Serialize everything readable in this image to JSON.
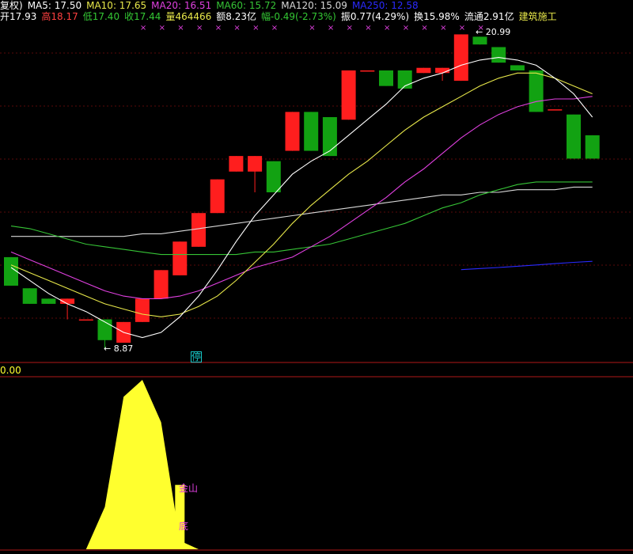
{
  "header": {
    "row1": [
      {
        "text": "复权)",
        "color": "#ffffff"
      },
      {
        "text": "MA5: 17.50",
        "color": "#ffffff"
      },
      {
        "text": "MA10: 17.65",
        "color": "#e8e84a"
      },
      {
        "text": "MA20: 16.51",
        "color": "#e040e0"
      },
      {
        "text": "MA60: 15.72",
        "color": "#36c436"
      },
      {
        "text": "MA120: 15.09",
        "color": "#d8d8d8"
      },
      {
        "text": "MA250: 12.58",
        "color": "#2a2aff"
      }
    ],
    "row2": [
      {
        "text": "开17.93",
        "color": "#ffffff"
      },
      {
        "text": "高18.17",
        "color": "#ff4040"
      },
      {
        "text": "低17.40",
        "color": "#34c834"
      },
      {
        "text": "收17.44",
        "color": "#34c834"
      },
      {
        "text": "量464466",
        "color": "#e8e84a"
      },
      {
        "text": "额8.23亿",
        "color": "#ffffff"
      },
      {
        "text": "幅-0.49(-2.73%)",
        "color": "#34c834"
      },
      {
        "text": "振0.77(4.29%)",
        "color": "#ffffff"
      },
      {
        "text": "换15.98%",
        "color": "#ffffff"
      },
      {
        "text": "流通2.91亿",
        "color": "#ffffff"
      },
      {
        "text": "建筑施工",
        "color": "#e8e84a"
      }
    ]
  },
  "annotations": {
    "low": "← 8.87",
    "high": "← 20.99",
    "stop_marker": "停",
    "indicator_value": "0.00",
    "signal_top": "金山",
    "signal_bottom": "底"
  },
  "colors": {
    "up": "#ff1e1e",
    "down": "#12a212",
    "ma5": "#ffffff",
    "ma10": "#e8e84a",
    "ma20": "#e040e0",
    "ma60": "#36c436",
    "ma120": "#d8d8d8",
    "ma250": "#2a2aff",
    "signal_area": "#ffff2e",
    "marker": "#e040e0"
  },
  "chart_data": {
    "type": "candlestick",
    "price_range": [
      8.4,
      21.4
    ],
    "candles": [
      {
        "open": 12.4,
        "close": 11.3,
        "high": 12.4,
        "low": 11.3
      },
      {
        "open": 11.2,
        "close": 10.6,
        "high": 11.2,
        "low": 10.6
      },
      {
        "open": 10.8,
        "close": 10.6,
        "high": 10.8,
        "low": 10.6
      },
      {
        "open": 10.6,
        "close": 10.8,
        "high": 10.8,
        "low": 10.0
      },
      {
        "open": 10.0,
        "close": 10.0,
        "high": 10.0,
        "low": 10.0
      },
      {
        "open": 10.0,
        "close": 9.2,
        "high": 10.0,
        "low": 8.87
      },
      {
        "open": 9.1,
        "close": 9.9,
        "high": 9.9,
        "low": 9.1
      },
      {
        "open": 9.9,
        "close": 10.8,
        "high": 10.8,
        "low": 9.9
      },
      {
        "open": 10.8,
        "close": 11.9,
        "high": 11.9,
        "low": 10.8
      },
      {
        "open": 11.7,
        "close": 13.0,
        "high": 13.0,
        "low": 11.7
      },
      {
        "open": 12.8,
        "close": 14.1,
        "high": 14.1,
        "low": 12.8
      },
      {
        "open": 14.1,
        "close": 15.4,
        "high": 15.4,
        "low": 14.1
      },
      {
        "open": 15.7,
        "close": 16.3,
        "high": 16.3,
        "low": 15.7
      },
      {
        "open": 15.7,
        "close": 16.3,
        "high": 16.3,
        "low": 14.9
      },
      {
        "open": 16.1,
        "close": 14.9,
        "high": 16.1,
        "low": 14.9
      },
      {
        "open": 16.5,
        "close": 18.0,
        "high": 18.0,
        "low": 16.5
      },
      {
        "open": 18.0,
        "close": 16.5,
        "high": 18.0,
        "low": 16.5
      },
      {
        "open": 17.8,
        "close": 16.3,
        "high": 17.8,
        "low": 16.3
      },
      {
        "open": 17.7,
        "close": 19.6,
        "high": 19.6,
        "low": 17.7
      },
      {
        "open": 19.6,
        "close": 19.6,
        "high": 19.6,
        "low": 19.6
      },
      {
        "open": 19.6,
        "close": 19.0,
        "high": 19.6,
        "low": 19.0
      },
      {
        "open": 19.6,
        "close": 18.9,
        "high": 19.6,
        "low": 18.9
      },
      {
        "open": 19.5,
        "close": 19.7,
        "high": 19.7,
        "low": 19.5
      },
      {
        "open": 19.5,
        "close": 19.7,
        "high": 19.7,
        "low": 19.2
      },
      {
        "open": 19.2,
        "close": 20.99,
        "high": 20.99,
        "low": 19.2
      },
      {
        "open": 20.9,
        "close": 20.6,
        "high": 20.9,
        "low": 20.6
      },
      {
        "open": 20.5,
        "close": 19.9,
        "high": 20.5,
        "low": 19.9
      },
      {
        "open": 19.8,
        "close": 19.6,
        "high": 19.8,
        "low": 19.6
      },
      {
        "open": 19.6,
        "close": 18.0,
        "high": 19.6,
        "low": 18.0
      },
      {
        "open": 18.1,
        "close": 18.1,
        "high": 18.1,
        "low": 18.1
      },
      {
        "open": 17.9,
        "close": 16.2,
        "high": 17.9,
        "low": 16.2
      },
      {
        "open": 17.1,
        "close": 16.2,
        "high": 17.1,
        "low": 16.2
      }
    ],
    "ma5": [
      12.0,
      11.5,
      11.0,
      10.6,
      10.3,
      9.9,
      9.5,
      9.3,
      9.5,
      10.1,
      10.9,
      11.9,
      13.0,
      14.0,
      14.8,
      15.6,
      16.1,
      16.5,
      17.1,
      17.7,
      18.3,
      19.0,
      19.3,
      19.5,
      19.8,
      20.0,
      20.1,
      20.0,
      19.8,
      19.3,
      18.7,
      17.8
    ],
    "ma10": [
      12.1,
      11.8,
      11.5,
      11.2,
      10.9,
      10.6,
      10.4,
      10.2,
      10.1,
      10.2,
      10.5,
      10.9,
      11.5,
      12.2,
      12.9,
      13.7,
      14.4,
      15.0,
      15.6,
      16.1,
      16.7,
      17.3,
      17.8,
      18.2,
      18.6,
      19.0,
      19.3,
      19.5,
      19.5,
      19.3,
      19.0,
      18.7
    ],
    "ma20": [
      12.6,
      12.3,
      12.0,
      11.7,
      11.4,
      11.1,
      10.9,
      10.8,
      10.8,
      10.9,
      11.1,
      11.4,
      11.7,
      12.0,
      12.2,
      12.4,
      12.8,
      13.2,
      13.7,
      14.2,
      14.7,
      15.3,
      15.8,
      16.4,
      17.0,
      17.5,
      17.9,
      18.2,
      18.4,
      18.5,
      18.5,
      18.6
    ],
    "ma60": [
      13.6,
      13.5,
      13.3,
      13.1,
      12.9,
      12.8,
      12.7,
      12.6,
      12.5,
      12.5,
      12.5,
      12.5,
      12.5,
      12.6,
      12.6,
      12.7,
      12.8,
      12.9,
      13.1,
      13.3,
      13.5,
      13.7,
      14.0,
      14.3,
      14.5,
      14.8,
      15.0,
      15.2,
      15.3,
      15.3,
      15.3,
      15.3
    ],
    "ma120": [
      13.2,
      13.2,
      13.2,
      13.2,
      13.2,
      13.2,
      13.2,
      13.3,
      13.3,
      13.4,
      13.5,
      13.6,
      13.7,
      13.8,
      13.9,
      14.0,
      14.1,
      14.2,
      14.3,
      14.4,
      14.5,
      14.6,
      14.7,
      14.8,
      14.8,
      14.9,
      14.9,
      15.0,
      15.0,
      15.0,
      15.1,
      15.1
    ],
    "ma250_segment": {
      "start_index": 24,
      "values": [
        11.92,
        11.96,
        12.0,
        12.05,
        12.1,
        12.15,
        12.2,
        12.24
      ]
    },
    "indicator": {
      "range": [
        0,
        100
      ],
      "values": [
        0,
        0,
        0,
        0,
        0,
        25,
        90,
        100,
        75,
        5,
        0,
        0,
        0,
        0,
        0,
        0,
        0,
        0,
        0,
        0,
        0,
        0,
        0,
        0,
        0,
        0,
        0,
        0,
        0,
        0,
        0,
        0
      ],
      "signal_bar_index": 9,
      "signal_bar_value": 38
    }
  }
}
